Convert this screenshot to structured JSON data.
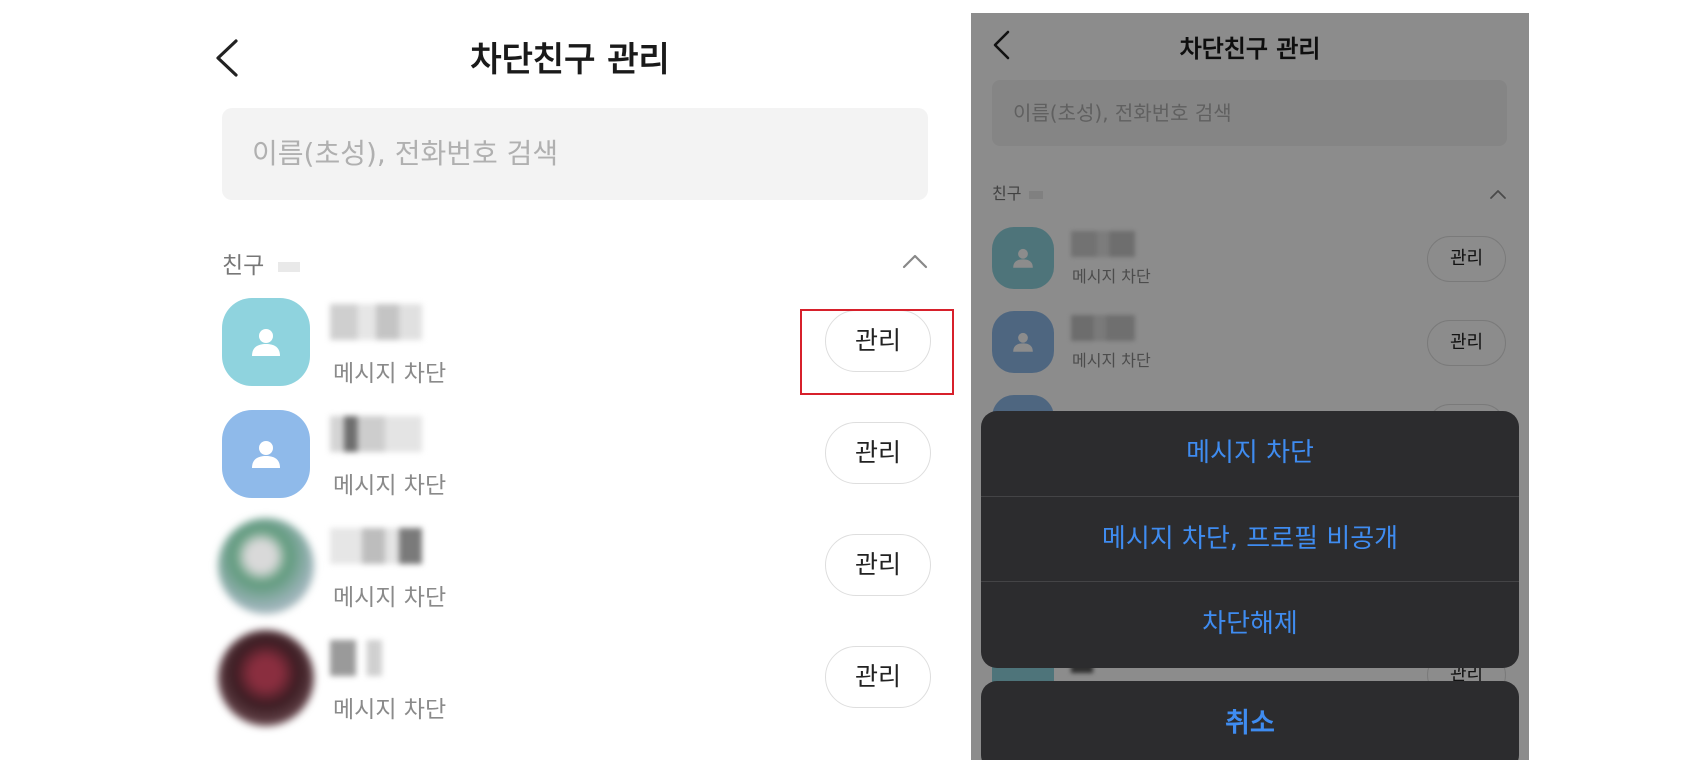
{
  "left": {
    "title": "차단친구 관리",
    "search_placeholder": "이름(초성), 전화번호 검색",
    "section_label": "친구",
    "rows": [
      {
        "status": "메시지 차단",
        "button": "관리",
        "avatar_color": "#8fd3de"
      },
      {
        "status": "메시지 차단",
        "button": "관리",
        "avatar_color": "#8fbaea"
      },
      {
        "status": "메시지 차단",
        "button": "관리",
        "avatar_color": "#7a9e8c"
      },
      {
        "status": "메시지 차단",
        "button": "관리",
        "avatar_color": "#5a2a34"
      }
    ],
    "highlight_color": "#d7202b"
  },
  "right": {
    "title": "차단친구 관리",
    "search_placeholder": "이름(초성), 전화번호 검색",
    "section_label": "친구",
    "rows": [
      {
        "status": "메시지 차단",
        "button": "관리"
      },
      {
        "status": "메시지 차단",
        "button": "관리"
      }
    ],
    "partial_button": "관리",
    "action_sheet": {
      "items": [
        "메시지 차단",
        "메시지 차단, 프로필 비공개",
        "차단해제"
      ],
      "cancel": "취소",
      "accent": "#3f8cf0"
    }
  }
}
